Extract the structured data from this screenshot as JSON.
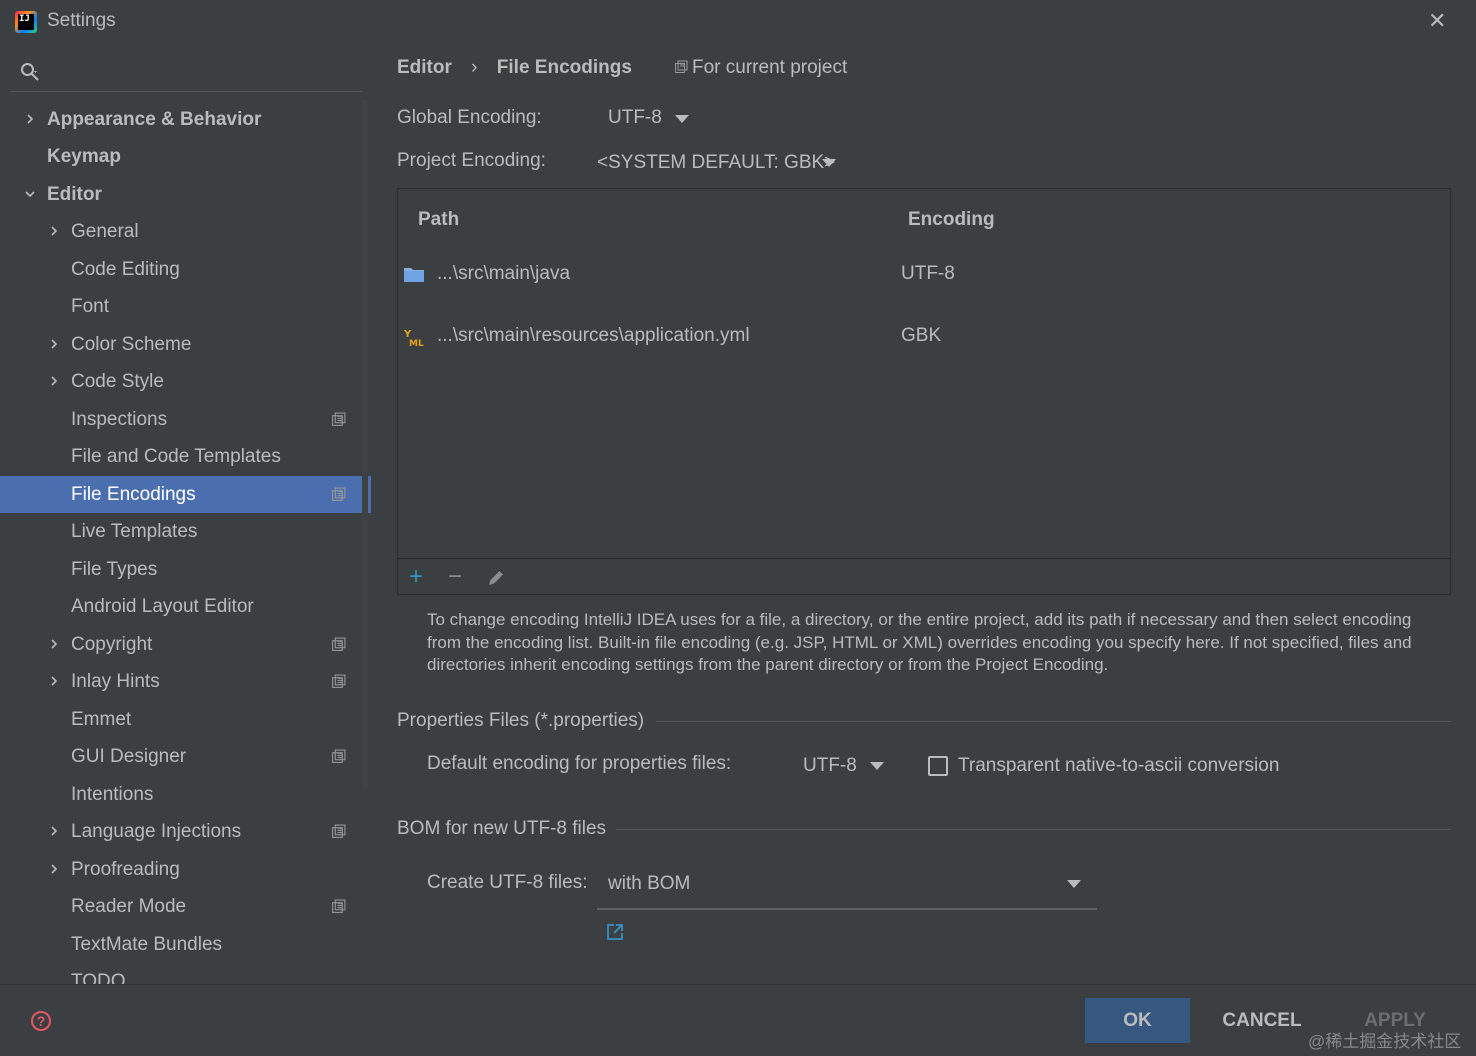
{
  "window": {
    "title": "Settings"
  },
  "search": {
    "placeholder": ""
  },
  "sidebar": {
    "items": [
      {
        "label": "Appearance & Behavior",
        "level": 0,
        "expandable": true,
        "expanded": false,
        "bold": true,
        "project_icon": false
      },
      {
        "label": "Keymap",
        "level": 0,
        "expandable": false,
        "bold": true,
        "project_icon": false
      },
      {
        "label": "Editor",
        "level": 0,
        "expandable": true,
        "expanded": true,
        "bold": true,
        "project_icon": false
      },
      {
        "label": "General",
        "level": 1,
        "expandable": true,
        "expanded": false,
        "project_icon": false
      },
      {
        "label": "Code Editing",
        "level": 1,
        "expandable": false,
        "project_icon": false
      },
      {
        "label": "Font",
        "level": 1,
        "expandable": false,
        "project_icon": false
      },
      {
        "label": "Color Scheme",
        "level": 1,
        "expandable": true,
        "expanded": false,
        "project_icon": false
      },
      {
        "label": "Code Style",
        "level": 1,
        "expandable": true,
        "expanded": false,
        "project_icon": false
      },
      {
        "label": "Inspections",
        "level": 1,
        "expandable": false,
        "project_icon": true
      },
      {
        "label": "File and Code Templates",
        "level": 1,
        "expandable": false,
        "project_icon": false
      },
      {
        "label": "File Encodings",
        "level": 1,
        "expandable": false,
        "project_icon": true,
        "selected": true
      },
      {
        "label": "Live Templates",
        "level": 1,
        "expandable": false,
        "project_icon": false
      },
      {
        "label": "File Types",
        "level": 1,
        "expandable": false,
        "project_icon": false
      },
      {
        "label": "Android Layout Editor",
        "level": 1,
        "expandable": false,
        "project_icon": false
      },
      {
        "label": "Copyright",
        "level": 1,
        "expandable": true,
        "expanded": false,
        "project_icon": true
      },
      {
        "label": "Inlay Hints",
        "level": 1,
        "expandable": true,
        "expanded": false,
        "project_icon": true
      },
      {
        "label": "Emmet",
        "level": 1,
        "expandable": false,
        "project_icon": false
      },
      {
        "label": "GUI Designer",
        "level": 1,
        "expandable": false,
        "project_icon": true
      },
      {
        "label": "Intentions",
        "level": 1,
        "expandable": false,
        "project_icon": false
      },
      {
        "label": "Language Injections",
        "level": 1,
        "expandable": true,
        "expanded": false,
        "project_icon": true
      },
      {
        "label": "Proofreading",
        "level": 1,
        "expandable": true,
        "expanded": false,
        "project_icon": false
      },
      {
        "label": "Reader Mode",
        "level": 1,
        "expandable": false,
        "project_icon": true
      },
      {
        "label": "TextMate Bundles",
        "level": 1,
        "expandable": false,
        "project_icon": false
      },
      {
        "label": "TODO",
        "level": 1,
        "expandable": false,
        "project_icon": false
      }
    ]
  },
  "breadcrumb": {
    "parent": "Editor",
    "separator": "›",
    "current": "File Encodings",
    "scope": "For current project"
  },
  "global_encoding": {
    "label": "Global Encoding:",
    "value": "UTF-8"
  },
  "project_encoding": {
    "label": "Project Encoding:",
    "value": "<SYSTEM DEFAULT: GBK>"
  },
  "table": {
    "headers": {
      "path": "Path",
      "encoding": "Encoding"
    },
    "rows": [
      {
        "icon": "folder-icon",
        "path": "...\\src\\main\\java",
        "encoding": "UTF-8"
      },
      {
        "icon": "yaml-file-icon",
        "path": "...\\src\\main\\resources\\application.yml",
        "encoding": "GBK"
      }
    ],
    "toolbar": {
      "add": "+",
      "remove": "−"
    }
  },
  "description": "To change encoding IntelliJ IDEA uses for a file, a directory, or the entire project, add its path if necessary and then select encoding from the encoding list. Built-in file encoding (e.g. JSP, HTML or XML) overrides encoding you specify here. If not specified, files and directories inherit encoding settings from the parent directory or from the Project Encoding.",
  "properties_section": {
    "title": "Properties Files (*.properties)",
    "default_label": "Default encoding for properties files:",
    "default_value": "UTF-8",
    "transparent_label": "Transparent native-to-ascii conversion",
    "transparent_checked": false
  },
  "bom_section": {
    "title": "BOM for new UTF-8 files",
    "create_label": "Create UTF-8 files:",
    "create_value": "with BOM"
  },
  "footer": {
    "ok": "OK",
    "cancel": "CANCEL",
    "apply": "APPLY",
    "watermark": "@稀土掘金技术社区"
  },
  "colors": {
    "background": "#3c3f41",
    "selection": "#4b6eaf",
    "ok_button": "#365880",
    "text": "#bbbbbb",
    "accent_blue": "#3592c4",
    "help_red": "#e55765"
  }
}
